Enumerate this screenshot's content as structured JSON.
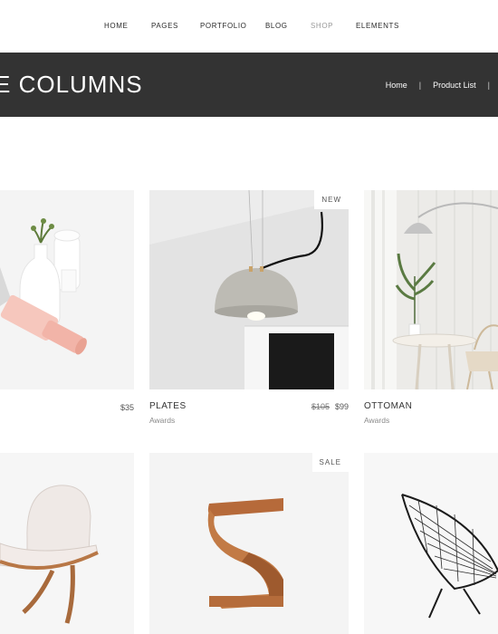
{
  "nav": {
    "items": [
      {
        "label": "HOME"
      },
      {
        "label": "PAGES"
      },
      {
        "label": "PORTFOLIO"
      },
      {
        "label": "BLOG"
      },
      {
        "label": "SHOP"
      },
      {
        "label": "ELEMENTS"
      }
    ],
    "active": "SHOP"
  },
  "header": {
    "title": "E COLUMNS",
    "breadcrumb": [
      "Home",
      "Product List"
    ]
  },
  "products": [
    {
      "name": "",
      "category": "",
      "price": "$35",
      "old_price": "",
      "badge": ""
    },
    {
      "name": "PLATES",
      "category": "Awards",
      "price": "$99",
      "old_price": "$105",
      "badge": "NEW"
    },
    {
      "name": "OTTOMAN",
      "category": "Awards",
      "price": "",
      "old_price": "",
      "badge": ""
    },
    {
      "name": "",
      "category": "",
      "price": "",
      "old_price": "",
      "badge": ""
    },
    {
      "name": "",
      "category": "",
      "price": "",
      "old_price": "",
      "badge": "SALE"
    },
    {
      "name": "",
      "category": "",
      "price": "",
      "old_price": "",
      "badge": ""
    }
  ],
  "colors": {
    "title_bar": "#333333",
    "nav_active": "#9a9a9a",
    "text": "#333333"
  }
}
